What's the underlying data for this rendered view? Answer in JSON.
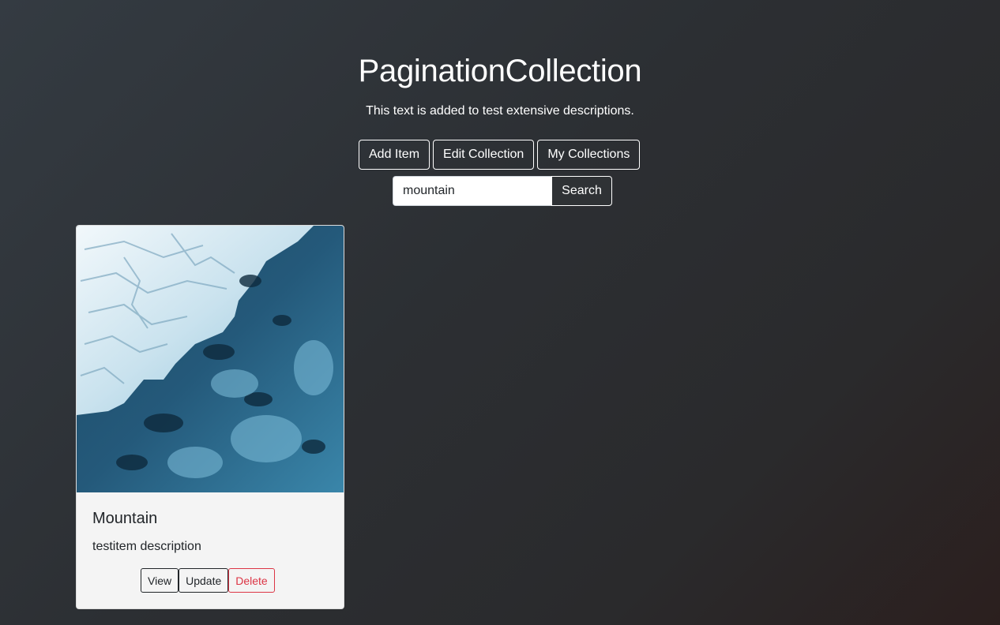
{
  "page": {
    "title": "PaginationCollection",
    "description": "This text is added to test extensive descriptions."
  },
  "actions": {
    "add_item": "Add Item",
    "edit_collection": "Edit Collection",
    "my_collections": "My Collections"
  },
  "search": {
    "value": "mountain",
    "button_label": "Search"
  },
  "items": [
    {
      "title": "Mountain",
      "description": "testitem description",
      "view_label": "View",
      "update_label": "Update",
      "delete_label": "Delete"
    }
  ],
  "colors": {
    "delete": "#dc3545",
    "card_background": "#f4f4f4"
  }
}
